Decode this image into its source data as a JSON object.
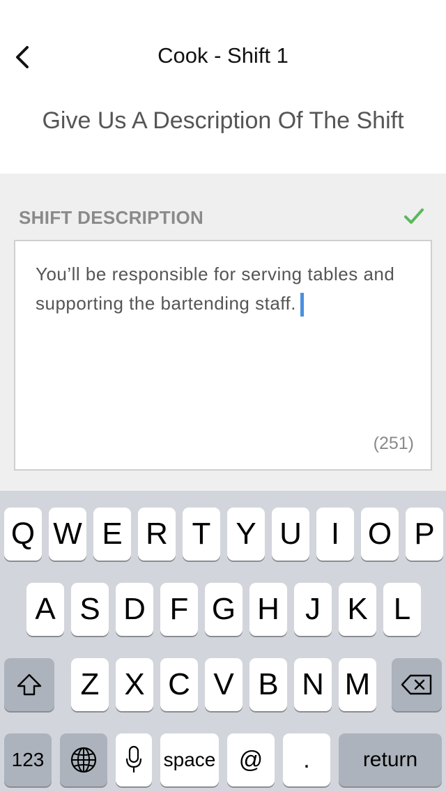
{
  "header": {
    "title": "Cook - Shift 1",
    "subtitle": "Give Us A Description Of The Shift"
  },
  "form": {
    "section_label": "SHIFT DESCRIPTION",
    "description_value": "You’ll be responsible for serving tables and supporting the bartending staff.",
    "char_count": "(251)"
  },
  "colors": {
    "accent": "#4a90e2",
    "valid": "#5cb85c",
    "background_gray": "#efefef"
  },
  "keyboard": {
    "row1": [
      "Q",
      "W",
      "E",
      "R",
      "T",
      "Y",
      "U",
      "I",
      "O",
      "P"
    ],
    "row2": [
      "A",
      "S",
      "D",
      "F",
      "G",
      "H",
      "J",
      "K",
      "L"
    ],
    "row3": [
      "Z",
      "X",
      "C",
      "V",
      "B",
      "N",
      "M"
    ],
    "numbers_label": "123",
    "space_label": "space",
    "at_label": "@",
    "dot_label": ".",
    "return_label": "return"
  }
}
